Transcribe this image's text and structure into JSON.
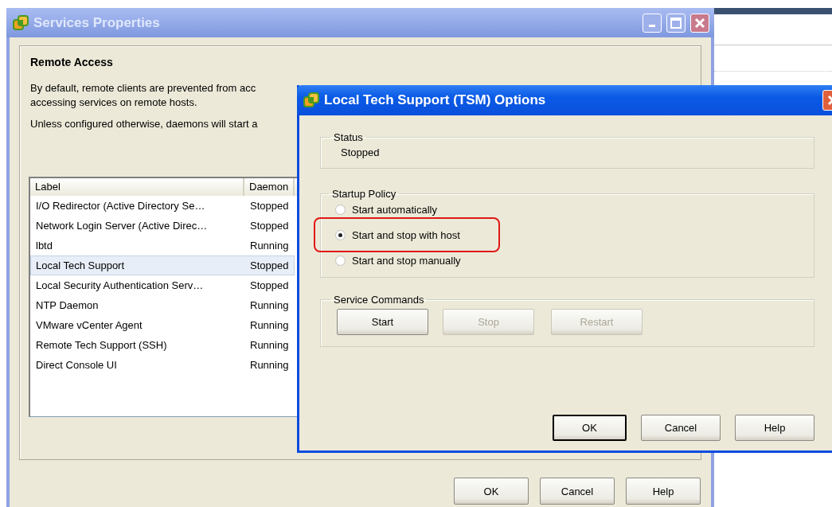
{
  "services_window": {
    "title": "Services Properties",
    "section_title": "Remote Access",
    "lines": [
      "By default, remote clients are prevented from acc",
      "accessing services on remote hosts.",
      "Unless configured otherwise, daemons will start a"
    ],
    "table": {
      "columns": [
        "Label",
        "Daemon"
      ],
      "rows": [
        {
          "label": "I/O Redirector (Active Directory Se…",
          "daemon": "Stopped",
          "selected": false
        },
        {
          "label": "Network Login Server (Active Direc…",
          "daemon": "Stopped",
          "selected": false
        },
        {
          "label": "lbtd",
          "daemon": "Running",
          "selected": false
        },
        {
          "label": "Local Tech Support",
          "daemon": "Stopped",
          "selected": true
        },
        {
          "label": "Local Security Authentication Serv…",
          "daemon": "Stopped",
          "selected": false
        },
        {
          "label": "NTP Daemon",
          "daemon": "Running",
          "selected": false
        },
        {
          "label": "VMware vCenter Agent",
          "daemon": "Running",
          "selected": false
        },
        {
          "label": "Remote Tech Support (SSH)",
          "daemon": "Running",
          "selected": false
        },
        {
          "label": "Direct Console UI",
          "daemon": "Running",
          "selected": false
        }
      ]
    },
    "buttons": [
      "OK",
      "Cancel",
      "Help"
    ]
  },
  "dialog": {
    "title": "Local Tech Support (TSM) Options",
    "status": {
      "legend": "Status",
      "value": "Stopped"
    },
    "startup_policy": {
      "legend": "Startup Policy",
      "options": [
        {
          "label": "Start automatically",
          "selected": false,
          "highlighted": false
        },
        {
          "label": "Start and stop with host",
          "selected": true,
          "highlighted": true
        },
        {
          "label": "Start and stop manually",
          "selected": false,
          "highlighted": false
        }
      ]
    },
    "service_commands": {
      "legend": "Service Commands",
      "buttons": [
        {
          "label": "Start",
          "disabled": false
        },
        {
          "label": "Stop",
          "disabled": true
        },
        {
          "label": "Restart",
          "disabled": true
        }
      ]
    },
    "buttons": [
      {
        "label": "OK",
        "default": true
      },
      {
        "label": "Cancel",
        "default": false
      },
      {
        "label": "Help",
        "default": false
      }
    ]
  }
}
